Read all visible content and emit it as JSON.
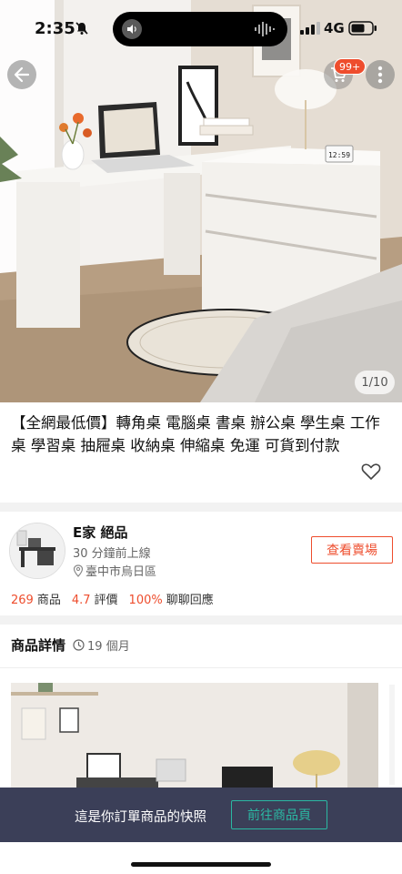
{
  "status_bar": {
    "time": "2:35",
    "network": "4G",
    "icons": [
      "bell-slash-icon",
      "speaker-icon",
      "waveform-icon",
      "signal-icon",
      "battery-icon"
    ]
  },
  "product_header": {
    "cart_badge": "99+",
    "image_counter": "1/10",
    "clock_display": "12:59",
    "icons": [
      "back-arrow-icon",
      "cart-icon",
      "more-icon"
    ]
  },
  "product": {
    "title": "【全網最低價】轉角桌 電腦桌 書桌 辦公桌 學生桌 工作桌 學習桌  抽屜桌 收納桌 伸縮桌 免運 可貨到付款",
    "icons": [
      "heart-icon"
    ]
  },
  "shop": {
    "name": "E家 絕品",
    "online_status": "30 分鐘前上線",
    "location": "臺中市烏日區",
    "view_button": "查看賣場",
    "products_count": "269",
    "products_label": "商品",
    "rating": "4.7",
    "rating_label": "評價",
    "response_rate": "100%",
    "response_label": "聊聊回應",
    "icons": [
      "location-pin-icon"
    ]
  },
  "details": {
    "title": "商品詳情",
    "age": "19 個月",
    "icons": [
      "clock-icon"
    ]
  },
  "snapshot_bar": {
    "text": "這是你訂單商品的快照",
    "button": "前往商品頁"
  },
  "colors": {
    "accent": "#ee4d2d",
    "snapshot_bg": "#3b3f58",
    "snapshot_button": "#2bb8a3"
  }
}
